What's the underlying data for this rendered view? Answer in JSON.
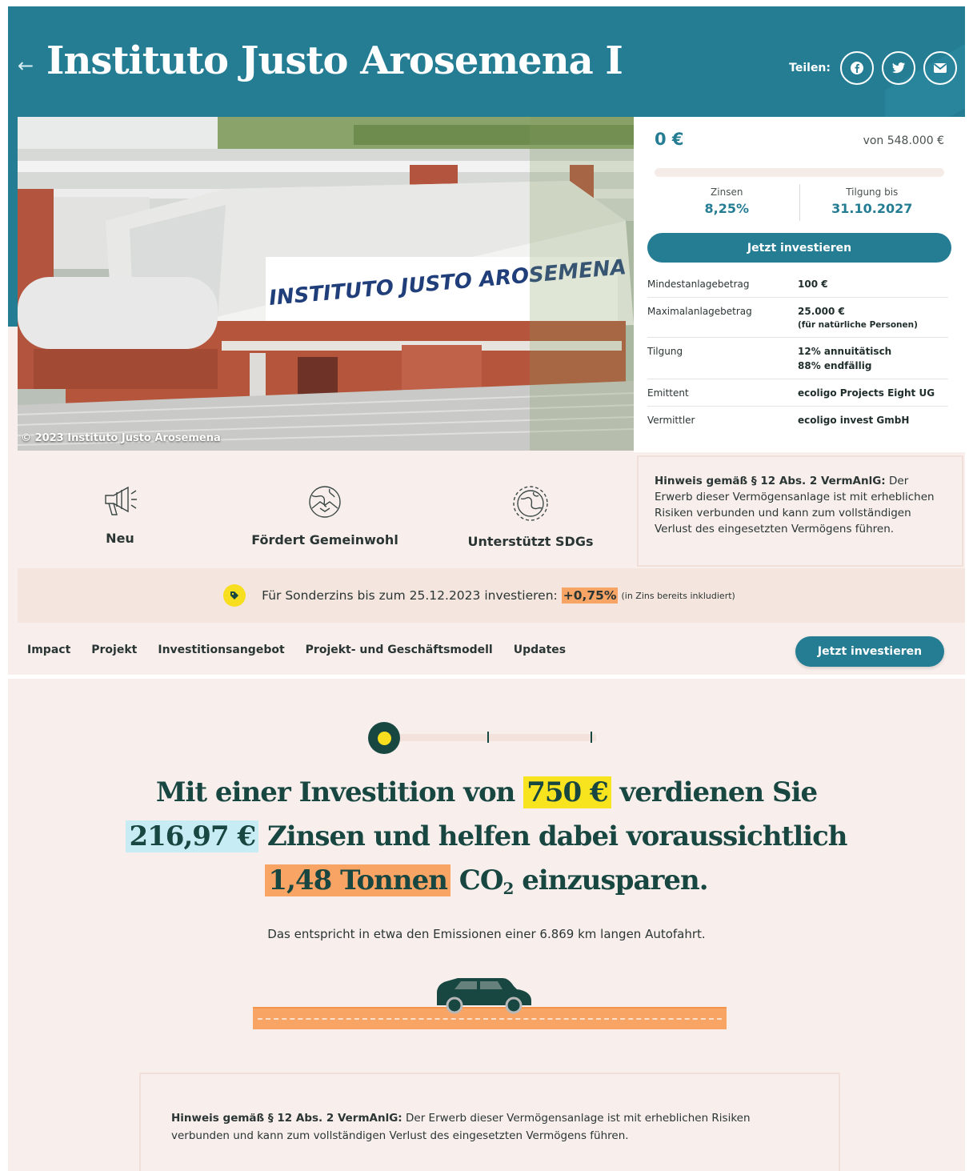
{
  "header": {
    "title": "Instituto Justo Arosemena I",
    "share_label": "Teilen:",
    "share_icons": [
      "facebook-icon",
      "twitter-icon",
      "mail-icon"
    ]
  },
  "photo": {
    "sign_text": "INSTITUTO JUSTO AROSEMENA",
    "credit": "© 2023 Instituto Justo Arosemena"
  },
  "summary": {
    "amount": "0 €",
    "total": "von 548.000 €",
    "progress": 0,
    "kpis": [
      {
        "label": "Zinsen",
        "value": "8,25%"
      },
      {
        "label": "Tilgung bis",
        "value": "31.10.2027"
      }
    ],
    "invest_button": "Jetzt investieren",
    "facts": [
      {
        "label": "Mindestanlagebetrag",
        "value": "100 €",
        "sub": ""
      },
      {
        "label": "Maximalanlagebetrag",
        "value": "25.000 €",
        "sub": "(für natürliche Personen)"
      },
      {
        "label": "Tilgung",
        "value": "12% annuitätisch",
        "sub": "88% endfällig"
      },
      {
        "label": "Emittent",
        "value": "ecoligo Projects Eight UG",
        "sub": ""
      },
      {
        "label": "Vermittler",
        "value": "ecoligo invest GmbH",
        "sub": ""
      }
    ]
  },
  "features": [
    {
      "label": "Neu",
      "icon": "megaphone-icon"
    },
    {
      "label": "Fördert Gemeinwohl",
      "icon": "globe-handshake-icon"
    },
    {
      "label": "Unterstützt SDGs",
      "icon": "globe-sdg-icon"
    }
  ],
  "notice_side": {
    "bold": "Hinweis gemäß § 12 Abs. 2 VermAnlG:",
    "text": " Der Erwerb dieser Vermögensanlage ist mit erheblichen Risiken verbunden und kann zum vollständigen Verlust des eingesetzten Vermögens führen."
  },
  "bonus": {
    "text": "Für Sonderzins bis zum 25.12.2023 investieren:",
    "highlight": "+0,75%",
    "note": "(in Zins bereits inkludiert)"
  },
  "nav": {
    "items": [
      "Impact",
      "Projekt",
      "Investitionsangebot",
      "Projekt- und Geschäftsmodell",
      "Updates"
    ],
    "button": "Jetzt investieren"
  },
  "calculator": {
    "line1_a": "Mit einer Investition von",
    "investment": "750 €",
    "line1_b": "verdienen Sie",
    "interest": "216,97 €",
    "line2_b": "Zinsen und helfen dabei voraussichtlich",
    "co2": "1,48 Tonnen",
    "line3_co": "CO",
    "line3_sub": "2",
    "line3_b": "einzusparen.",
    "equivalent": "Das entspricht in etwa den Emissionen einer 6.869 km langen Autofahrt."
  },
  "notice_bottom": {
    "bold": "Hinweis gemäß § 12 Abs. 2 VermAnlG:",
    "text": " Der Erwerb dieser Vermögensanlage ist mit erheblichen Risiken verbunden und kann zum vollständigen Verlust des eingesetzten Vermögens führen."
  }
}
